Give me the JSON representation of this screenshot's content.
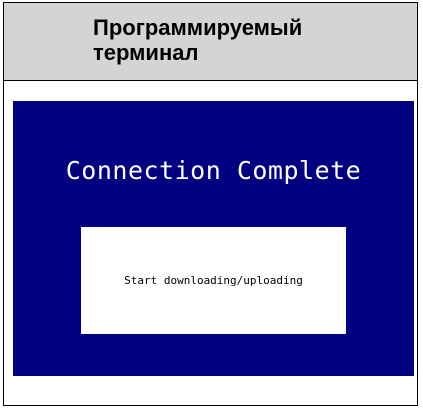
{
  "header": {
    "title_line1": "Программируемый",
    "title_line2": "терминал"
  },
  "screen": {
    "background_color": "#000080",
    "title": "Connection Complete",
    "message": "Start downloading/uploading"
  }
}
